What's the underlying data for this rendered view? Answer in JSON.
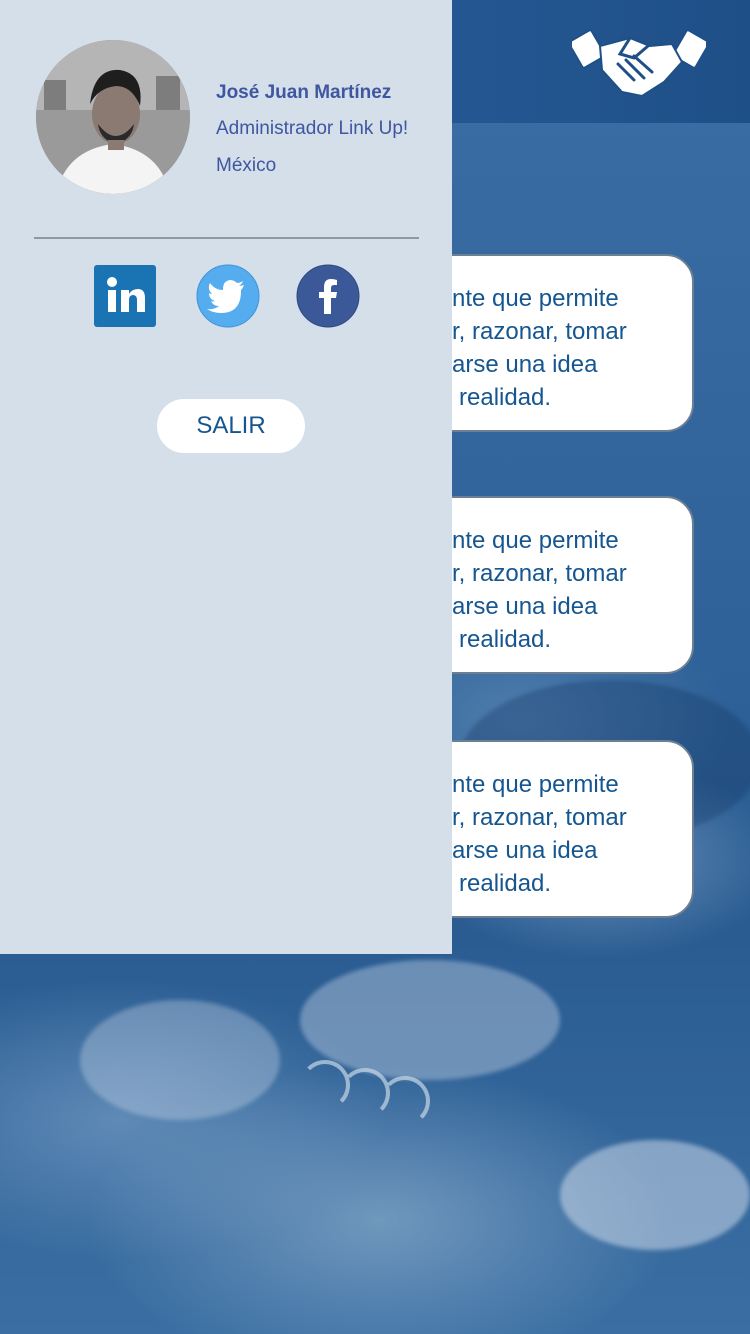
{
  "profile": {
    "name": "José Juan Martínez",
    "role": "Administrador Link Up!",
    "country": "México"
  },
  "social": [
    {
      "icon": "linkedin-icon",
      "color": "#1a74b3"
    },
    {
      "icon": "twitter-icon",
      "color": "#55acee"
    },
    {
      "icon": "facebook-icon",
      "color": "#3b5998"
    }
  ],
  "logout_label": "SALIR",
  "cards": [
    {
      "lines": [
        "nte que permite",
        "r, razonar, tomar",
        "arse una idea",
        "realidad."
      ]
    },
    {
      "lines": [
        "nte que permite",
        "r, razonar, tomar",
        "arse una idea",
        "realidad."
      ]
    },
    {
      "lines": [
        "nte que permite",
        "r, razonar, tomar",
        "arse una idea",
        "realidad."
      ]
    }
  ],
  "header": {
    "logo_icon": "handshake-icon"
  },
  "colors": {
    "drawer_bg": "#d4dfea",
    "accent_text": "#3f56a0",
    "card_text": "#165690",
    "header_bg": "#1f4f87"
  }
}
